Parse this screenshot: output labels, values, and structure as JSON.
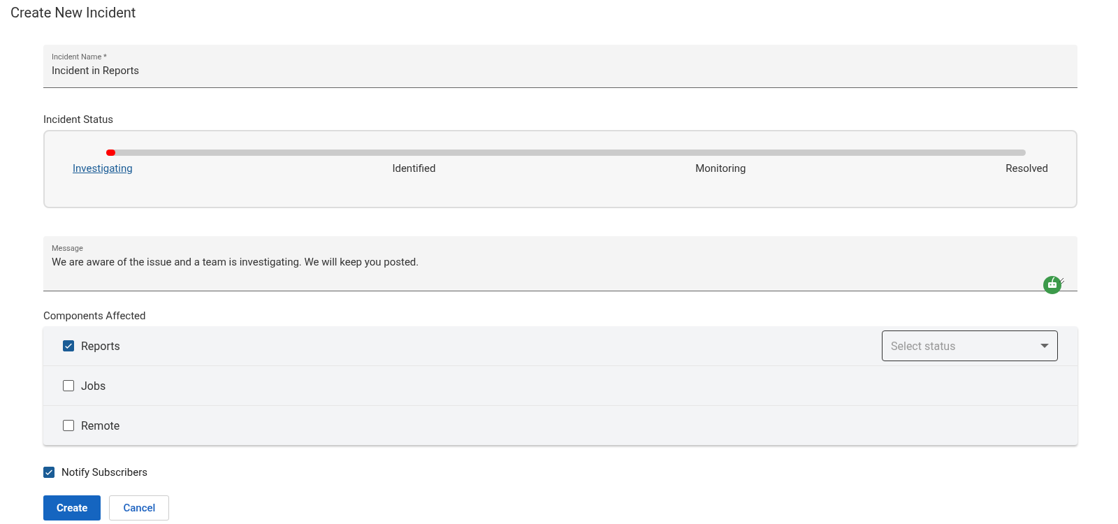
{
  "title": "Create New Incident",
  "incident_name": {
    "label": "Incident Name *",
    "value": "Incident in Reports"
  },
  "incident_status": {
    "label": "Incident Status",
    "level": 0.01,
    "steps": [
      {
        "label": "Investigating",
        "selected": true
      },
      {
        "label": "Identified",
        "selected": false
      },
      {
        "label": "Monitoring",
        "selected": false
      },
      {
        "label": "Resolved",
        "selected": false
      }
    ]
  },
  "message": {
    "label": "Message",
    "value": "We are aware of the issue and a team is investigating. We will keep you posted."
  },
  "components": {
    "label": "Components Affected",
    "items": [
      {
        "name": "Reports",
        "checked": true,
        "status_select": {
          "placeholder": "Select status"
        }
      },
      {
        "name": "Jobs",
        "checked": false
      },
      {
        "name": "Remote",
        "checked": false
      }
    ]
  },
  "notify_subscribers": {
    "label": "Notify Subscribers",
    "checked": true
  },
  "buttons": [
    {
      "label": "Create",
      "kind": "primary"
    },
    {
      "label": "Cancel",
      "kind": "secondary"
    }
  ]
}
